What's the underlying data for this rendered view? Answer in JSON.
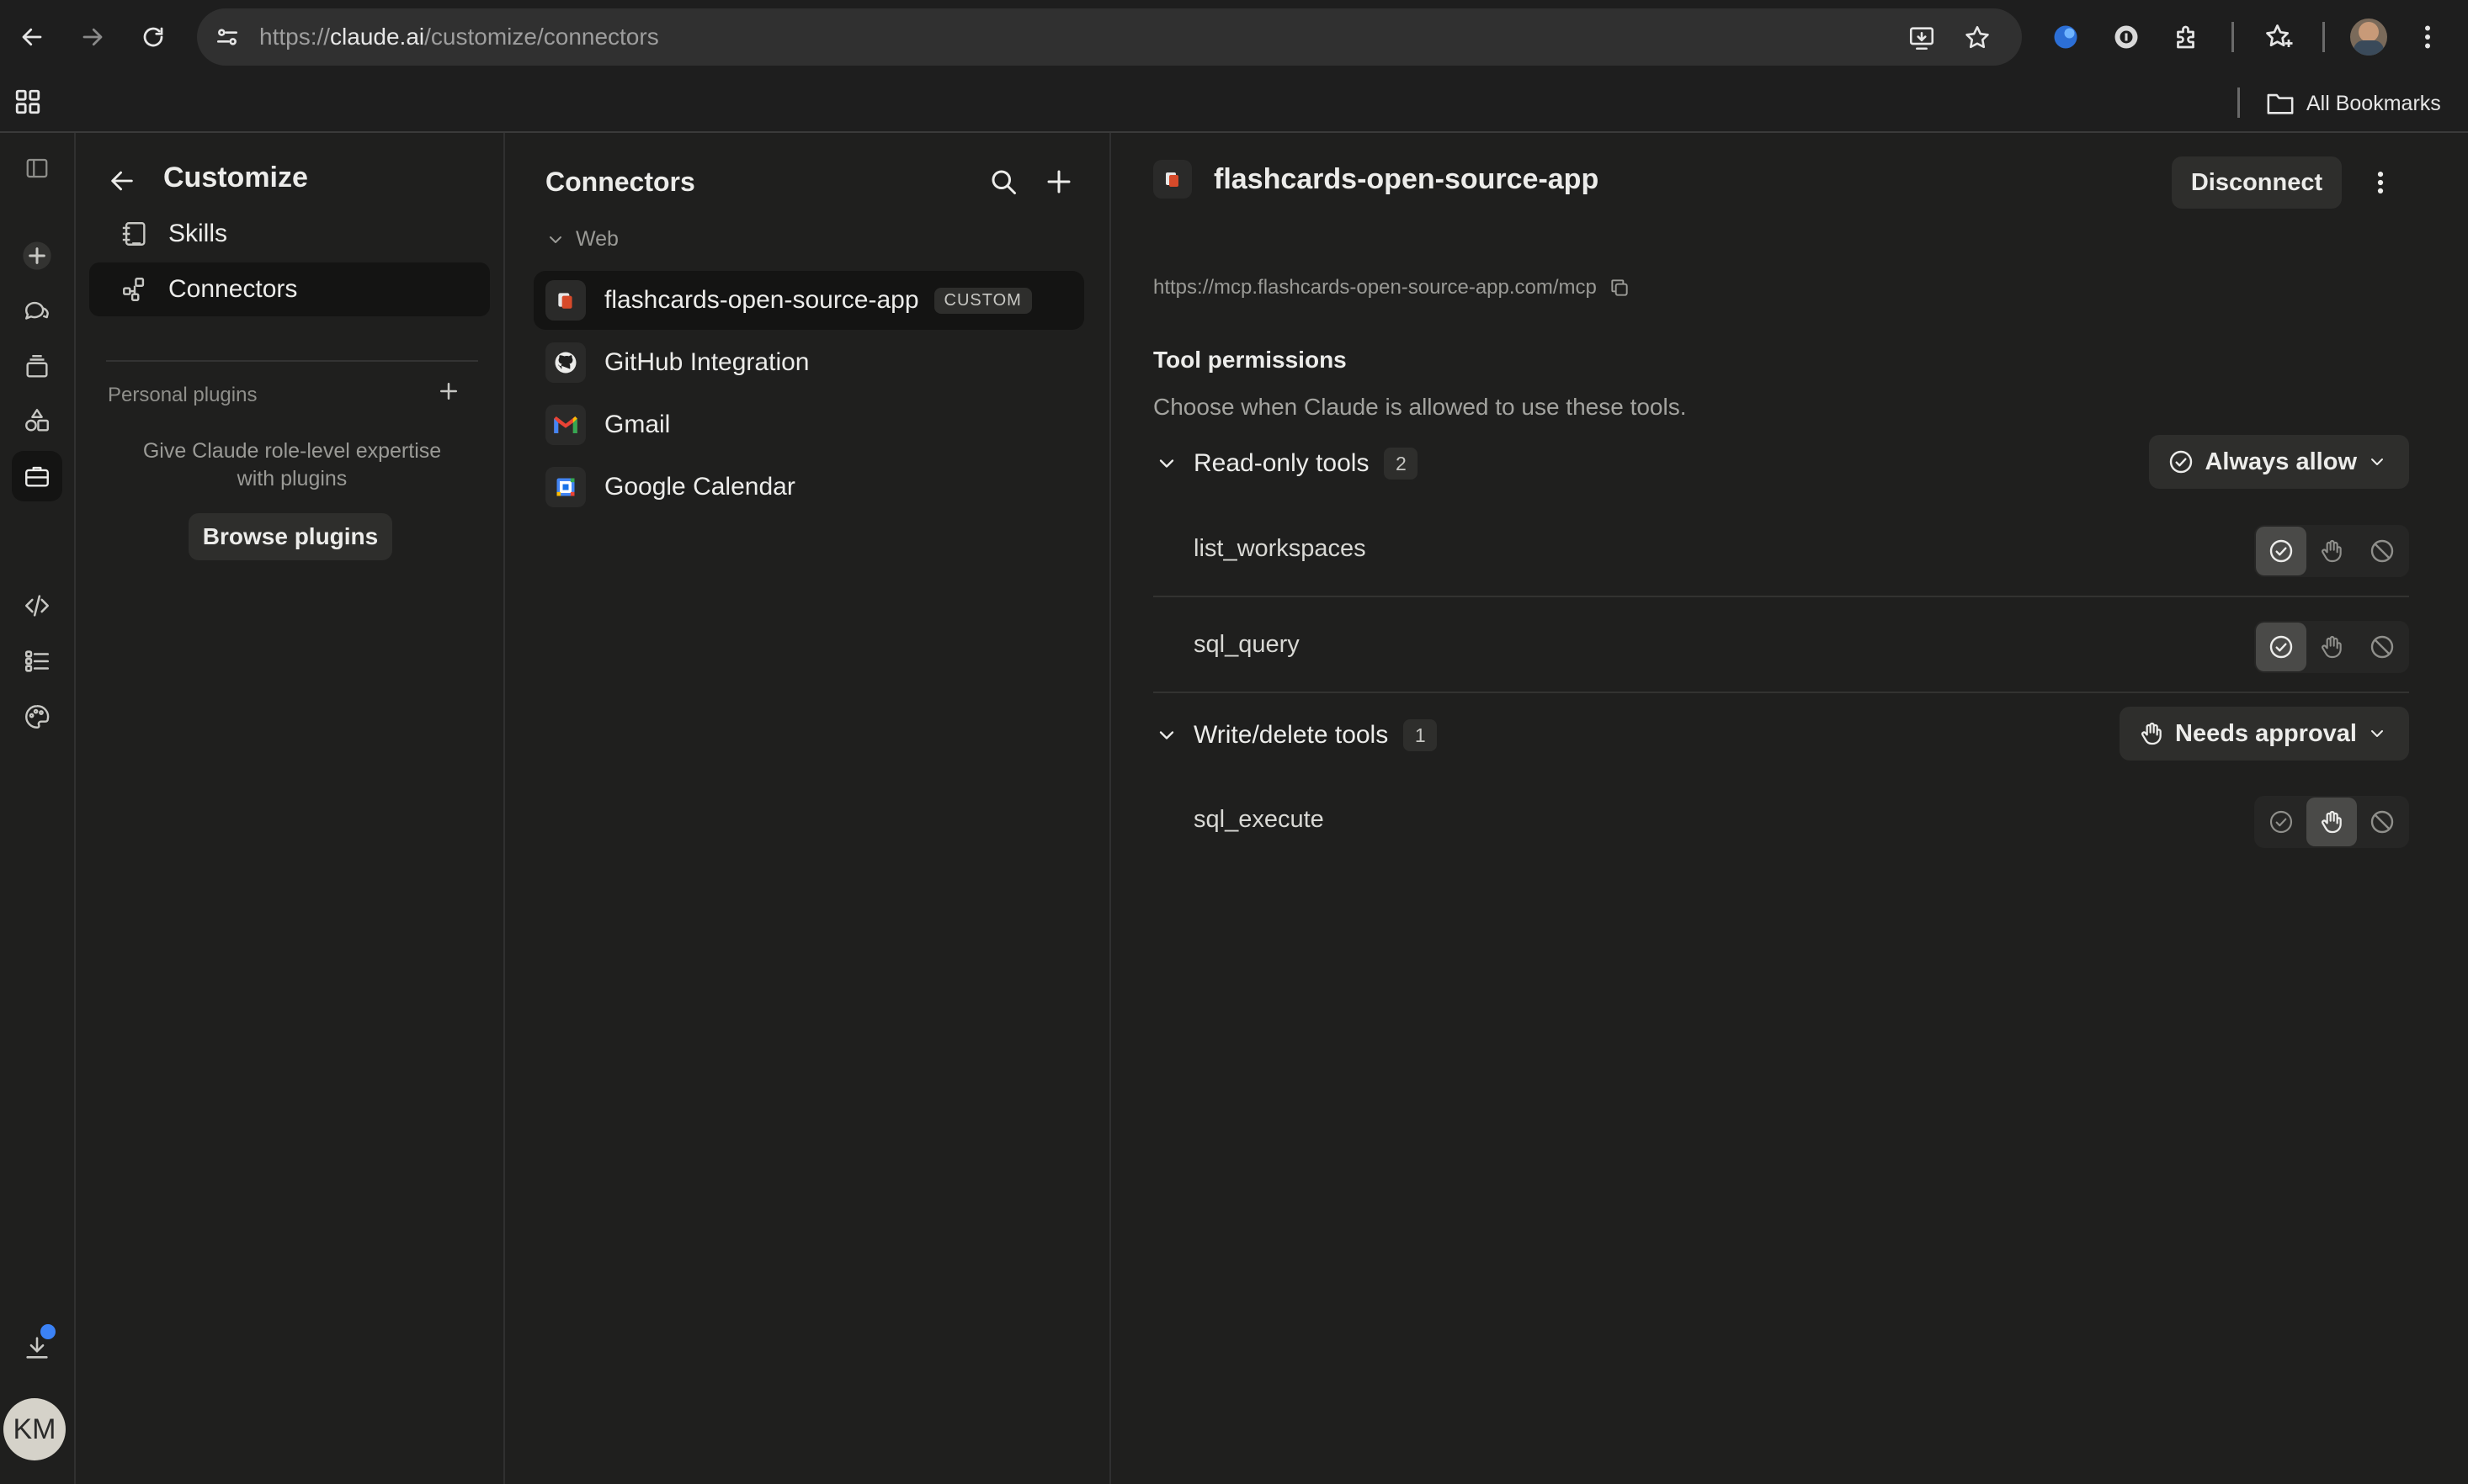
{
  "browser": {
    "url_scheme": "https://",
    "url_host": "claude.ai",
    "url_path": "/customize/connectors",
    "all_bookmarks": "All Bookmarks"
  },
  "rail": {
    "avatar_initials": "KM"
  },
  "customize": {
    "title": "Customize",
    "nav": [
      {
        "label": "Skills"
      },
      {
        "label": "Connectors"
      }
    ],
    "personal_plugins_label": "Personal plugins",
    "personal_plugins_desc": "Give Claude role-level expertise with plugins",
    "browse_plugins": "Browse plugins"
  },
  "connectors": {
    "title": "Connectors",
    "group": "Web",
    "items": [
      {
        "label": "flashcards-open-source-app",
        "badge": "CUSTOM",
        "icon": "flashcards-app-icon"
      },
      {
        "label": "GitHub Integration",
        "icon": "github-icon"
      },
      {
        "label": "Gmail",
        "icon": "gmail-icon"
      },
      {
        "label": "Google Calendar",
        "icon": "google-calendar-icon"
      }
    ]
  },
  "detail": {
    "title": "flashcards-open-source-app",
    "disconnect": "Disconnect",
    "url": "https://mcp.flashcards-open-source-app.com/mcp",
    "tool_permissions_title": "Tool permissions",
    "tool_permissions_desc": "Choose when Claude is allowed to use these tools.",
    "groups": [
      {
        "name": "Read-only tools",
        "count": "2",
        "permission": "Always allow",
        "tools": [
          {
            "name": "list_workspaces",
            "selected": "allow"
          },
          {
            "name": "sql_query",
            "selected": "allow"
          }
        ]
      },
      {
        "name": "Write/delete tools",
        "count": "1",
        "permission": "Needs approval",
        "tools": [
          {
            "name": "sql_execute",
            "selected": "approval"
          }
        ]
      }
    ]
  },
  "colors": {
    "background": "#1f1f1e",
    "active_item": "#141413",
    "notification_dot": "#3b82f6"
  }
}
